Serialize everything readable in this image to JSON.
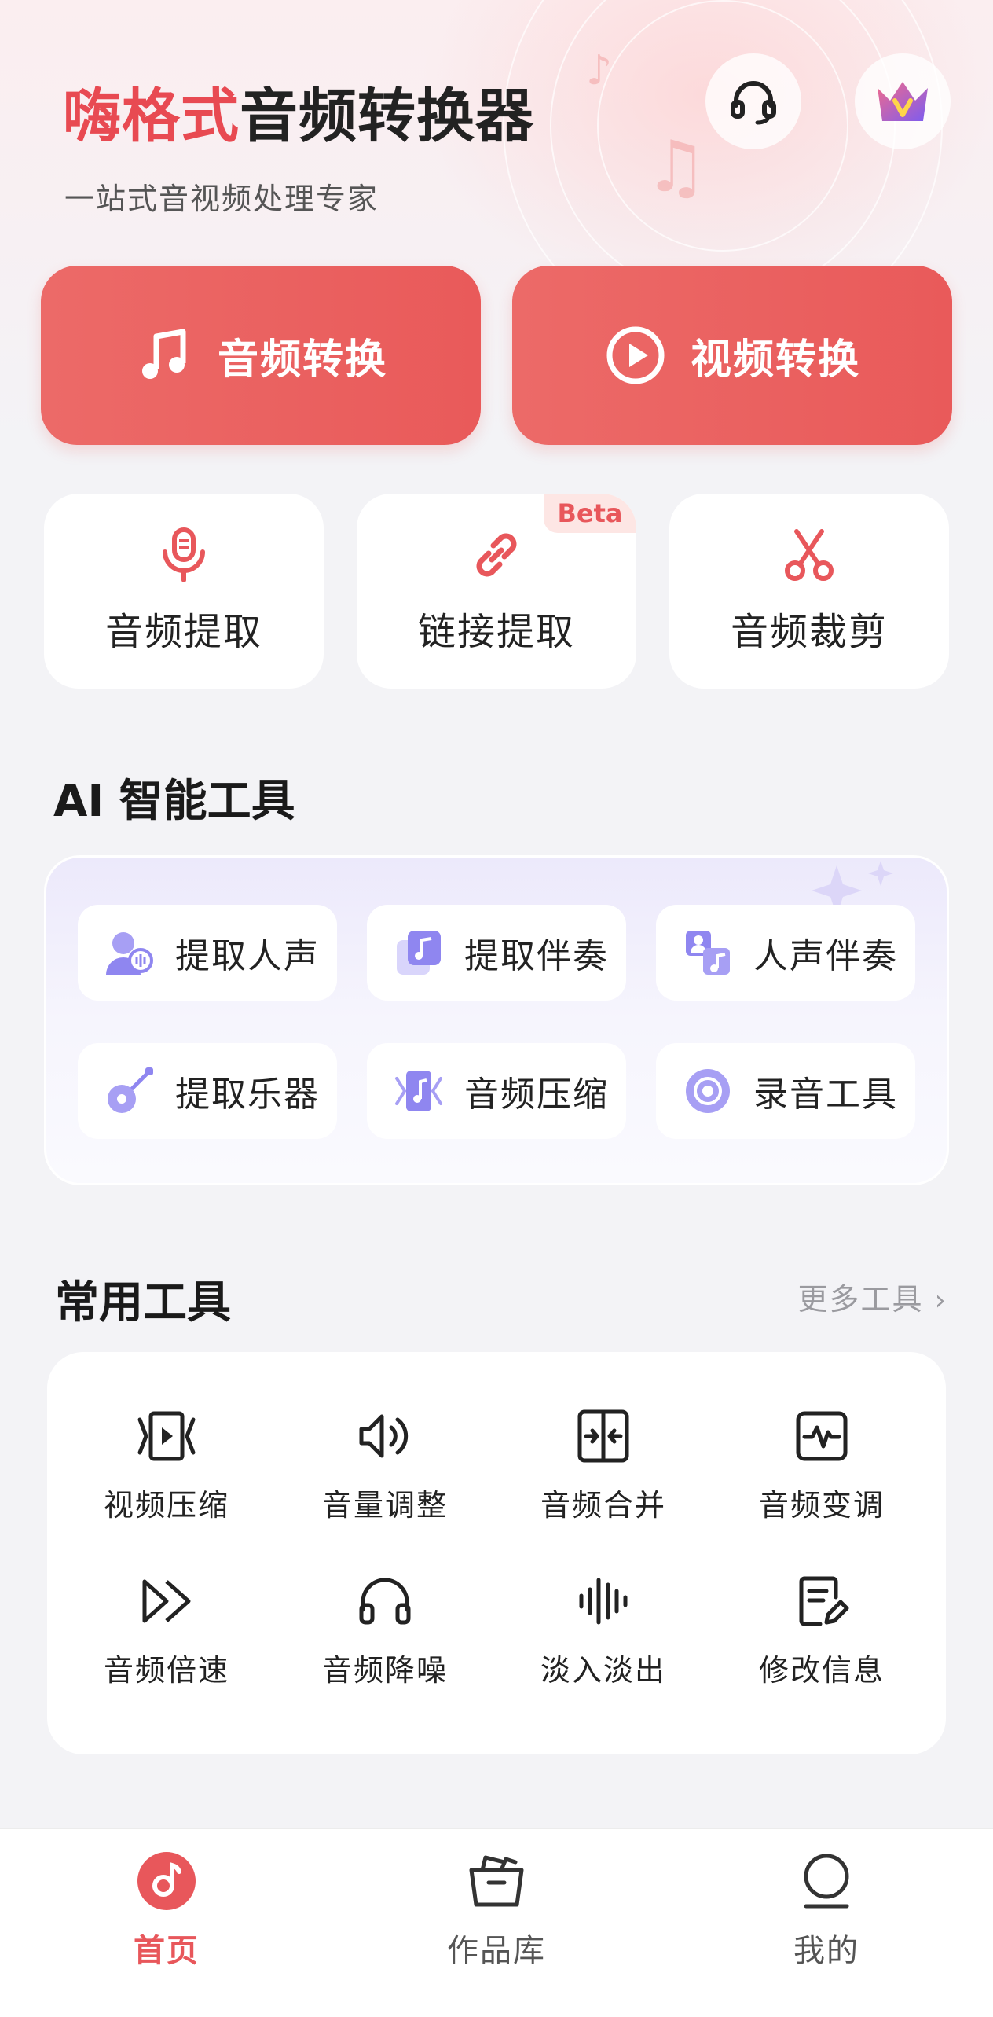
{
  "header": {
    "title_highlight": "嗨格式",
    "title_rest": "音频转换器",
    "subtitle": "一站式音视频处理专家",
    "support_icon": "headset-icon",
    "vip_icon": "crown-vip-icon"
  },
  "primary_actions": [
    {
      "label": "音频转换",
      "icon": "music-note-icon"
    },
    {
      "label": "视频转换",
      "icon": "play-circle-icon"
    }
  ],
  "quick_tools": [
    {
      "label": "音频提取",
      "icon": "microphone-icon"
    },
    {
      "label": "链接提取",
      "icon": "link-icon",
      "badge": "Beta"
    },
    {
      "label": "音频裁剪",
      "icon": "scissors-icon"
    }
  ],
  "ai_section": {
    "title": "AI 智能工具",
    "items": [
      {
        "label": "提取人声",
        "icon": "voice-person-icon"
      },
      {
        "label": "提取伴奏",
        "icon": "accompaniment-icon"
      },
      {
        "label": "人声伴奏",
        "icon": "voice-accompaniment-icon"
      },
      {
        "label": "提取乐器",
        "icon": "guitar-icon"
      },
      {
        "label": "音频压缩",
        "icon": "audio-compress-icon"
      },
      {
        "label": "录音工具",
        "icon": "record-icon"
      }
    ]
  },
  "common_section": {
    "title": "常用工具",
    "more_label": "更多工具",
    "items": [
      {
        "label": "视频压缩",
        "icon": "video-compress-icon"
      },
      {
        "label": "音量调整",
        "icon": "volume-icon"
      },
      {
        "label": "音频合并",
        "icon": "merge-icon"
      },
      {
        "label": "音频变调",
        "icon": "waveform-box-icon"
      },
      {
        "label": "音频倍速",
        "icon": "fast-forward-icon"
      },
      {
        "label": "音频降噪",
        "icon": "headphones-icon"
      },
      {
        "label": "淡入淡出",
        "icon": "sound-bars-icon"
      },
      {
        "label": "修改信息",
        "icon": "edit-document-icon"
      }
    ]
  },
  "tabbar": {
    "tabs": [
      {
        "label": "首页",
        "icon": "home-music-icon",
        "active": true
      },
      {
        "label": "作品库",
        "icon": "folder-box-icon",
        "active": false
      },
      {
        "label": "我的",
        "icon": "profile-icon",
        "active": false
      }
    ]
  },
  "colors": {
    "accent": "#e8575b",
    "ai_icon": "#8f86f0",
    "inactive_tab": "#555555"
  }
}
